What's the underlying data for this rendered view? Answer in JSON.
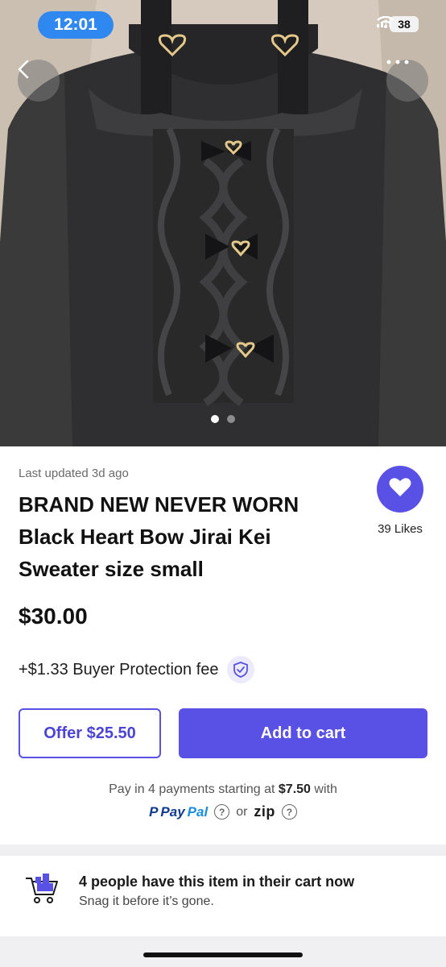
{
  "status_bar": {
    "time": "12:01",
    "battery": "38"
  },
  "listing": {
    "last_updated": "Last updated 3d ago",
    "title": "BRAND NEW NEVER WORN Black Heart Bow Jirai Kei Sweater size small",
    "price": "$30.00",
    "fee_text": "+$1.33 Buyer Protection fee",
    "likes": "39 Likes",
    "photo_count": 2,
    "active_photo": 1
  },
  "actions": {
    "offer_label": "Offer $25.50",
    "add_to_cart_label": "Add to cart"
  },
  "pay_later": {
    "prefix": "Pay in 4 payments starting at",
    "amount": "$7.50",
    "suffix": "with",
    "paypal_a": "Pay",
    "paypal_b": "Pal",
    "or": "or",
    "zip": "zip"
  },
  "cart_notice": {
    "title": "4 people have this item in their cart now",
    "subtitle": "Snag it before it’s gone."
  },
  "icons": {
    "back": "chevron-left-icon",
    "more": "more-dots-icon",
    "heart": "heart-icon",
    "shield": "shield-check-icon",
    "help": "question-icon",
    "cart": "shopping-cart-icon"
  },
  "colors": {
    "accent": "#5951e6",
    "status_pill": "#2f87f0"
  }
}
